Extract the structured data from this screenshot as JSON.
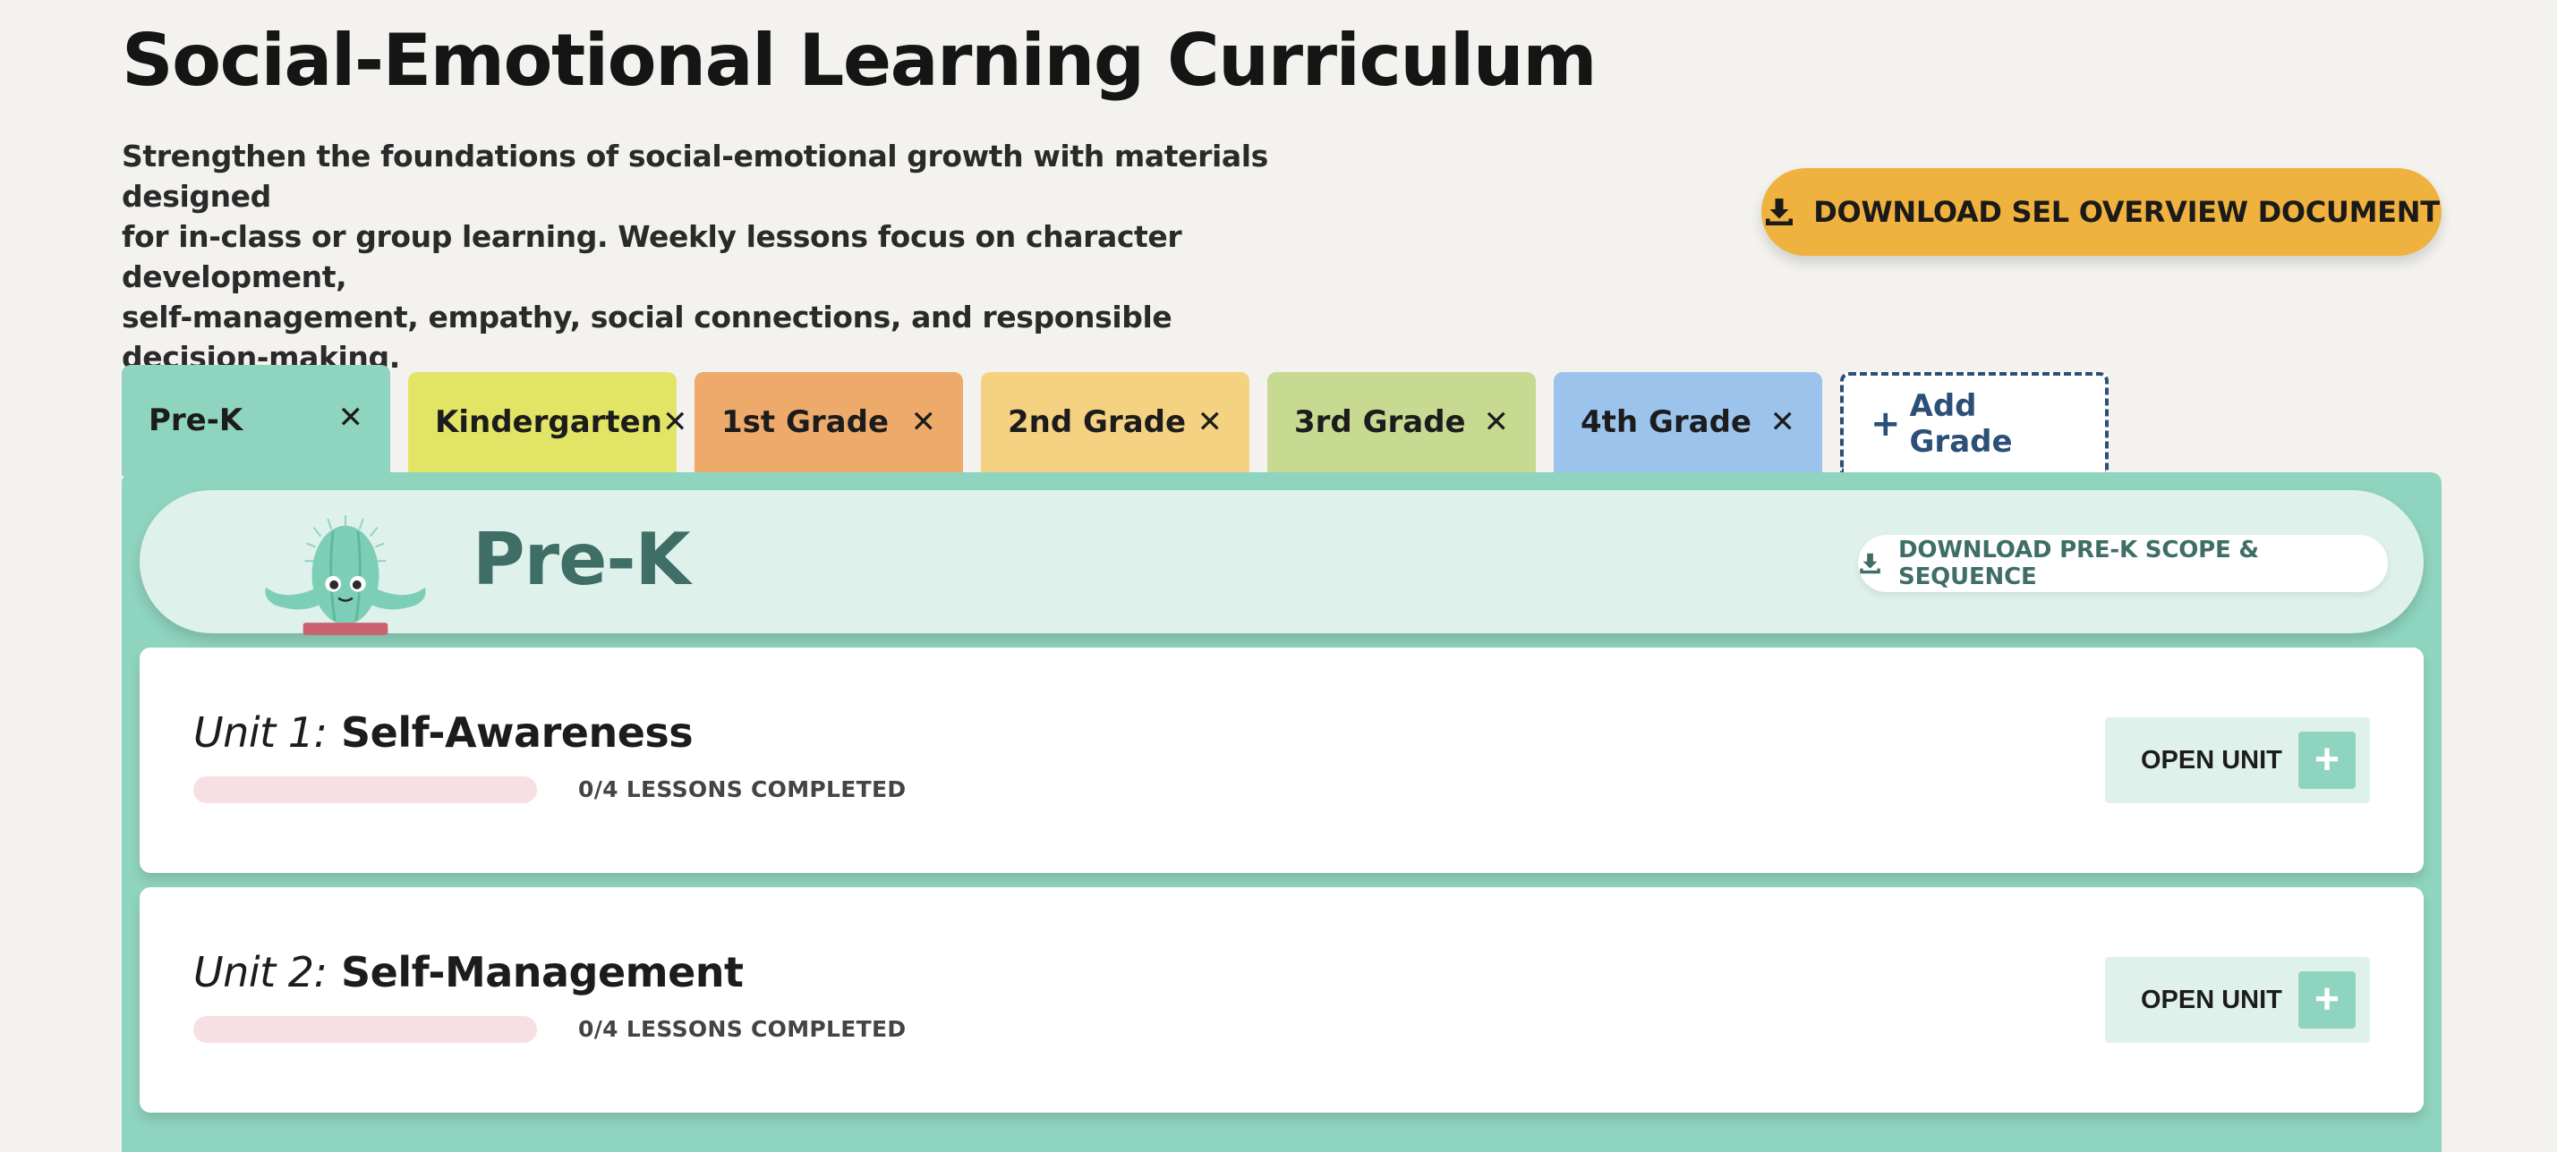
{
  "page": {
    "title": "Social-Emotional Learning Curriculum",
    "intro_lines": [
      "Strengthen the foundations of social-emotional growth with materials designed",
      "for in-class or group learning. Weekly lessons focus on character development,",
      "self-management, empathy, social connections, and responsible decision-making."
    ],
    "overview_button": "DOWNLOAD SEL OVERVIEW DOCUMENT"
  },
  "tabs": [
    {
      "label": "Pre-K",
      "color": "#8fd4bf",
      "active": true
    },
    {
      "label": "Kindergarten",
      "color": "#e2e466",
      "active": false
    },
    {
      "label": "1st Grade",
      "color": "#eeaa6a",
      "active": false
    },
    {
      "label": "2nd Grade",
      "color": "#f5d282",
      "active": false
    },
    {
      "label": "3rd Grade",
      "color": "#c8d991",
      "active": false
    },
    {
      "label": "4th Grade",
      "color": "#9cc3ec",
      "active": false
    }
  ],
  "add_tab": {
    "plus": "+",
    "label": "Add Grade"
  },
  "close_glyph": "✕",
  "grade_panel": {
    "title": "Pre-K",
    "scope_button": "DOWNLOAD PRE-K SCOPE & SEQUENCE"
  },
  "units": [
    {
      "number": "Unit 1:",
      "name": "Self-Awareness",
      "completed": 0,
      "total": 4,
      "progress_text": "0/4 LESSONS COMPLETED",
      "button_label": "OPEN UNIT",
      "button_icon": "+"
    },
    {
      "number": "Unit 2:",
      "name": "Self-Management",
      "completed": 0,
      "total": 4,
      "progress_text": "0/4 LESSONS COMPLETED",
      "button_label": "OPEN UNIT",
      "button_icon": "+"
    }
  ],
  "colors": {
    "accent_teal": "#8fd4bf",
    "download_yellow": "#f0b23e",
    "title_teal": "#3e6e66",
    "progress_track": "#f7dfe3",
    "add_tab_border": "#2c4f78"
  },
  "icons": {
    "download": "download-icon",
    "close": "close-icon",
    "plus": "plus-icon",
    "mascot": "cactus-mascot-icon"
  }
}
